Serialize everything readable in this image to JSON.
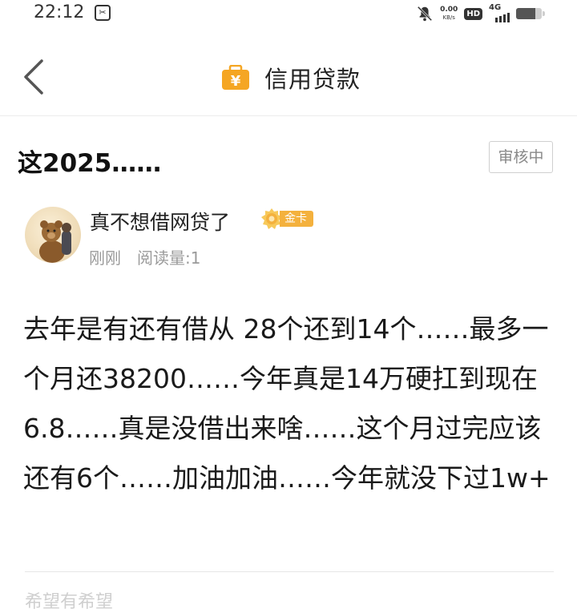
{
  "status_bar": {
    "time": "22:12",
    "net_speed_value": "0.00",
    "net_speed_unit": "KB/s",
    "hd_label": "HD",
    "network_label": "4G",
    "battery_level": 0.75,
    "icons": [
      "scissor-icon",
      "bell-muted-icon",
      "signal-icon",
      "battery-icon"
    ]
  },
  "header": {
    "title": "信用贷款",
    "icon": "wallet-yuan-icon",
    "accent": "#f5a623"
  },
  "post": {
    "title": "这2025……",
    "status": "审核中",
    "author": {
      "name": "真不想借网贷了",
      "badge_label": "金卡",
      "badge_color": "#f4b13d"
    },
    "time": "刚刚",
    "reads": "阅读量:1",
    "body": "去年是有还有借从 28个还到14个……最多一个月还38200……今年真是14万硬扛到现在6.8……真是没借出来啥……这个月过完应该还有6个……加油加油……今年就没下过1w+"
  },
  "footer": {
    "partial_text": "希望有希望"
  }
}
